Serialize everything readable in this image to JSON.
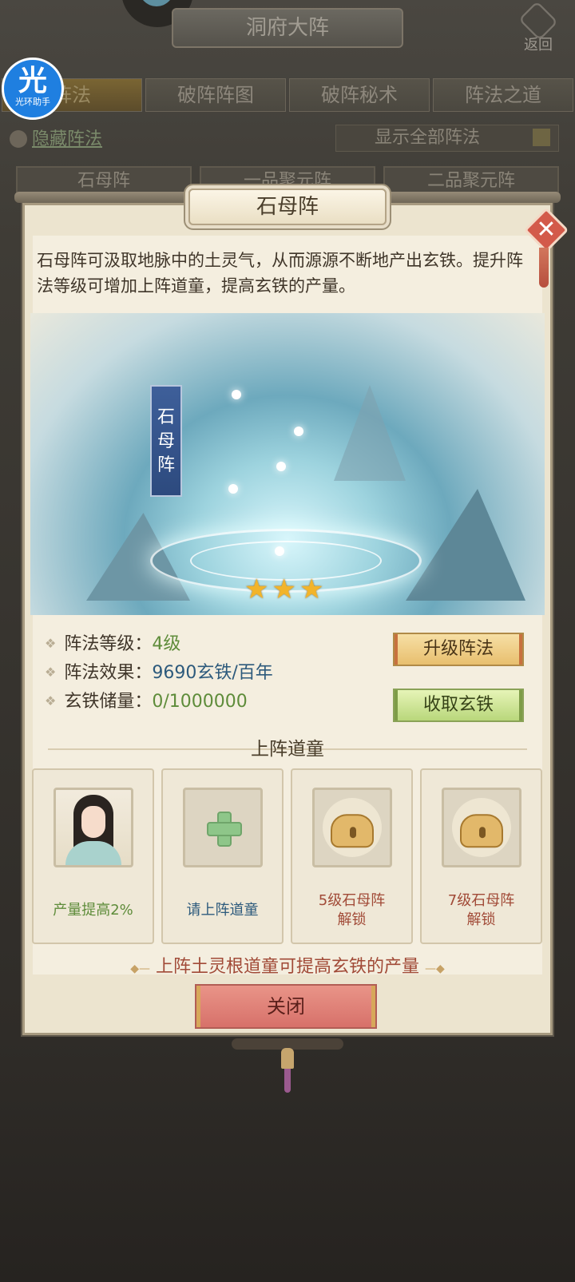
{
  "screen": {
    "title": "洞府大阵",
    "back_label": "返回",
    "assistant": {
      "big": "光",
      "small": "光环助手"
    },
    "tabs": [
      "阵法",
      "破阵阵图",
      "破阵秘术",
      "阵法之道"
    ],
    "hide_label": "隐藏阵法",
    "filter_label": "显示全部阵法",
    "formations": [
      "石母阵",
      "一品聚元阵",
      "二品聚元阵"
    ]
  },
  "modal": {
    "title": "石母阵",
    "description": "石母阵可汲取地脉中的土灵气，从而源源不断地产出玄铁。提升阵法等级可增加上阵道童，提高玄铁的产量。",
    "art_label": "石母阵",
    "stars": 3,
    "stats": {
      "level_label": "阵法等级：",
      "level_value": "4级",
      "effect_label": "阵法效果：",
      "effect_value": "9690玄铁/百年",
      "storage_label": "玄铁储量：",
      "storage_value": "0/1000000"
    },
    "upgrade_button": "升级阵法",
    "collect_button": "收取玄铁",
    "section_title": "上阵道童",
    "slots": [
      {
        "text": "产量提高2%",
        "type": "portrait"
      },
      {
        "text": "请上阵道童",
        "type": "add"
      },
      {
        "text_line1": "5级石母阵",
        "text_line2": "解锁",
        "type": "locked"
      },
      {
        "text_line1": "7级石母阵",
        "text_line2": "解锁",
        "type": "locked"
      }
    ],
    "hint": "上阵土灵根道童可提高玄铁的产量",
    "close_button": "关闭",
    "colors": {
      "green": "#5e8c3a",
      "blue": "#2d5a7c",
      "red": "#a14a37",
      "star": "#f2b42a"
    }
  }
}
